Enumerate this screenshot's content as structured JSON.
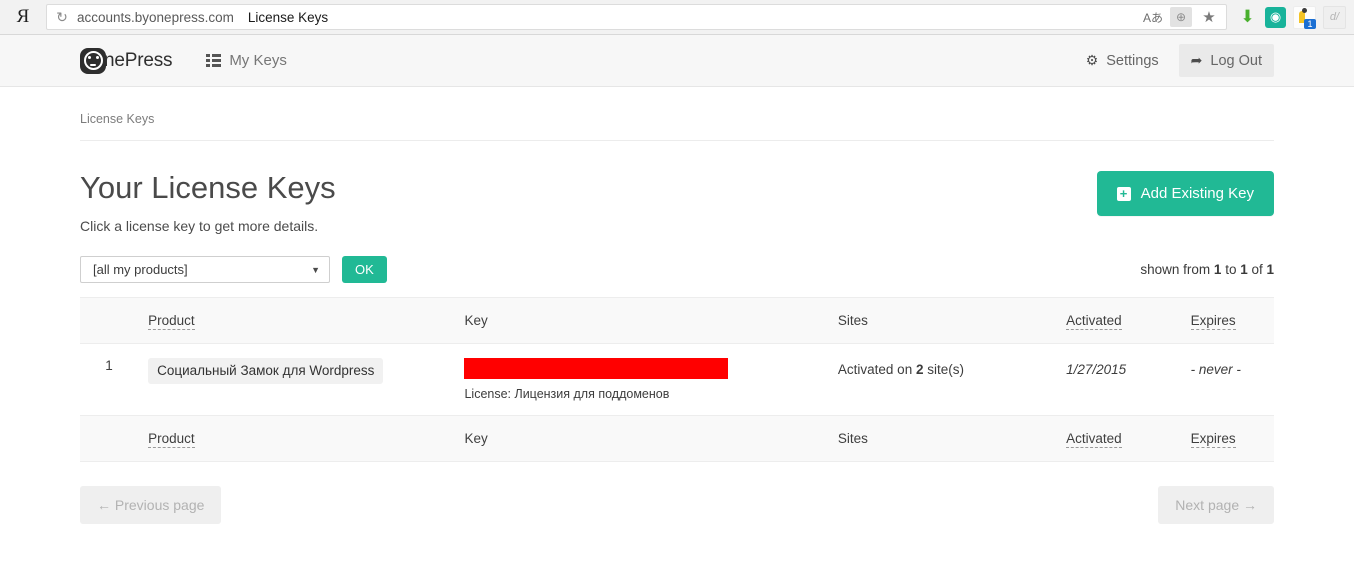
{
  "browser": {
    "vendor_logo": "yandex-logo",
    "reload_icon": "reload-icon",
    "url": "accounts.byonepress.com",
    "page_title": "License Keys",
    "omni_icons": [
      "translate-icon",
      "puzzle-icon",
      "bookmark-star-icon"
    ],
    "extension_icons": [
      "download-arrow-icon",
      "adguard-icon",
      "password-manager-icon",
      "dictionary-icon"
    ],
    "extension_badge": "1"
  },
  "header": {
    "brand": "nePress",
    "brand_icon": "onepress-logo-icon",
    "nav": {
      "my_keys": "My Keys",
      "my_keys_icon": "list-icon"
    },
    "settings": "Settings",
    "settings_icon": "gear-icon",
    "logout": "Log Out",
    "logout_icon": "sign-out-icon"
  },
  "breadcrumb": "License Keys",
  "page": {
    "title": "Your License Keys",
    "subtitle": "Click a license key to get more details.",
    "add_key_button": "Add Existing Key",
    "add_key_icon": "plus-square-icon"
  },
  "filter": {
    "selected": "[all my products]",
    "caret_icon": "chevron-down-icon",
    "ok_button": "OK",
    "shown_prefix": "shown from ",
    "shown_from": "1",
    "shown_mid": " to ",
    "shown_to": "1",
    "shown_suffix": " of ",
    "shown_total": "1"
  },
  "table": {
    "headers": {
      "num": "",
      "product": "Product",
      "key": "Key",
      "sites": "Sites",
      "activated": "Activated",
      "expires": "Expires"
    },
    "row": {
      "num": "1",
      "product": "Социальный Замок для Wordpress",
      "key_redacted_color": "#ff0000",
      "license_label": "License: Лицензия для поддоменов",
      "sites_prefix": "Activated on ",
      "sites_count": "2",
      "sites_suffix": " site(s)",
      "activated": "1/27/2015",
      "expires": "- never -"
    }
  },
  "pagination": {
    "previous": "← Previous page",
    "next": "Next page →"
  },
  "colors": {
    "accent_green": "#21b995",
    "redaction_red": "#ff0000",
    "header_bg": "#f7f7f7",
    "table_stripe": "#f9f9f9"
  }
}
